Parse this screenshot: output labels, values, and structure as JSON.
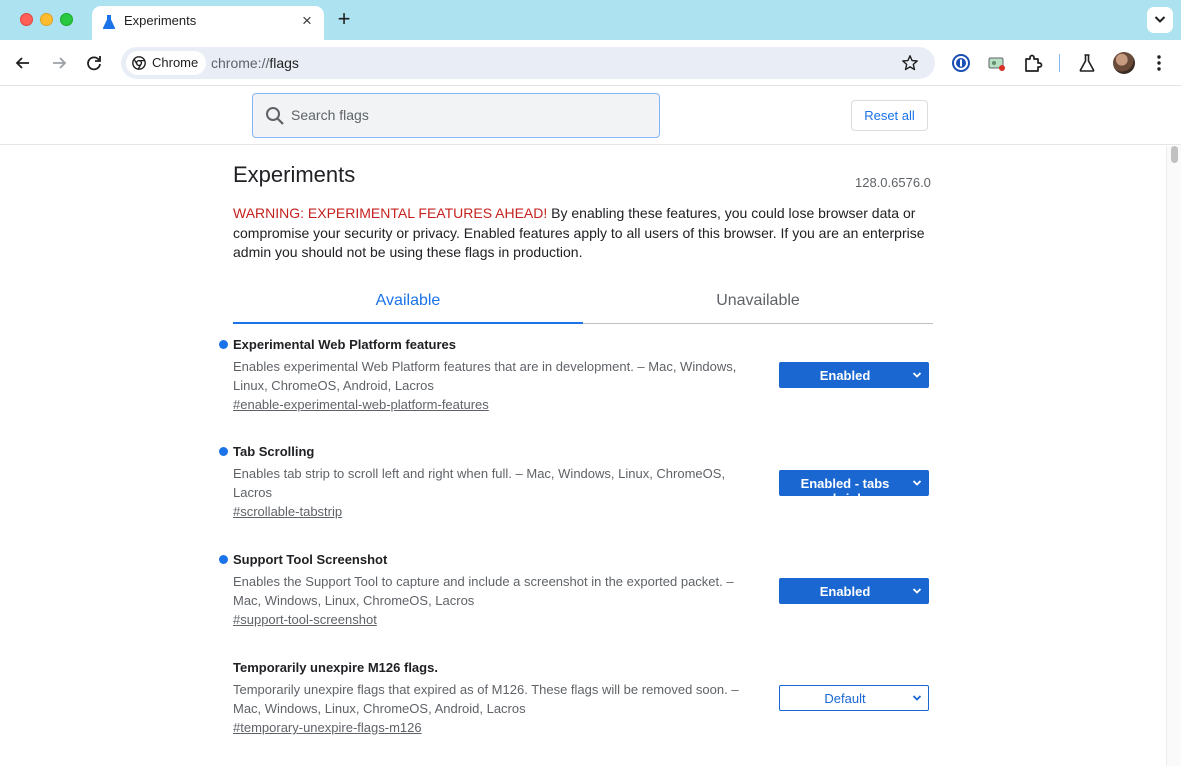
{
  "browser": {
    "tab_title": "Experiments",
    "new_tab_symbol": "+",
    "omnibox": {
      "chip_label": "Chrome",
      "url_scheme": "chrome://",
      "url_path": "flags"
    },
    "icons": [
      "back-icon",
      "forward-icon",
      "reload-icon",
      "bookmark-star-icon",
      "password-manager-icon",
      "extension-badge-icon",
      "extensions-puzzle-icon",
      "labs-flask-icon",
      "profile-avatar",
      "menu-kebab-icon"
    ]
  },
  "header": {
    "search_placeholder": "Search flags",
    "reset_label": "Reset all"
  },
  "page": {
    "title": "Experiments",
    "version": "128.0.6576.0",
    "warning_prefix": "WARNING: EXPERIMENTAL FEATURES AHEAD!",
    "warning_body": " By enabling these features, you could lose browser data or compromise your security or privacy. Enabled features apply to all users of this browser. If you are an enterprise admin you should not be using these flags in production.",
    "tabs": [
      "Available",
      "Unavailable"
    ],
    "accent_color": "#1a73e8",
    "warning_color": "#c5221f"
  },
  "flags": [
    {
      "name": "Experimental Web Platform features",
      "description": "Enables experimental Web Platform features that are in development. – Mac, Windows, Linux, ChromeOS, Android, Lacros",
      "link": "#enable-experimental-web-platform-features",
      "value": "Enabled",
      "modified": true
    },
    {
      "name": "Tab Scrolling",
      "description": "Enables tab strip to scroll left and right when full. – Mac, Windows, Linux, ChromeOS, Lacros",
      "link": "#scrollable-tabstrip",
      "value": "Enabled - tabs shrink",
      "modified": true
    },
    {
      "name": "Support Tool Screenshot",
      "description": "Enables the Support Tool to capture and include a screenshot in the exported packet. – Mac, Windows, Linux, ChromeOS, Lacros",
      "link": "#support-tool-screenshot",
      "value": "Enabled",
      "modified": true
    },
    {
      "name": "Temporarily unexpire M126 flags.",
      "description": "Temporarily unexpire flags that expired as of M126. These flags will be removed soon. – Mac, Windows, Linux, ChromeOS, Android, Lacros",
      "link": "#temporary-unexpire-flags-m126",
      "value": "Default",
      "modified": false
    }
  ]
}
